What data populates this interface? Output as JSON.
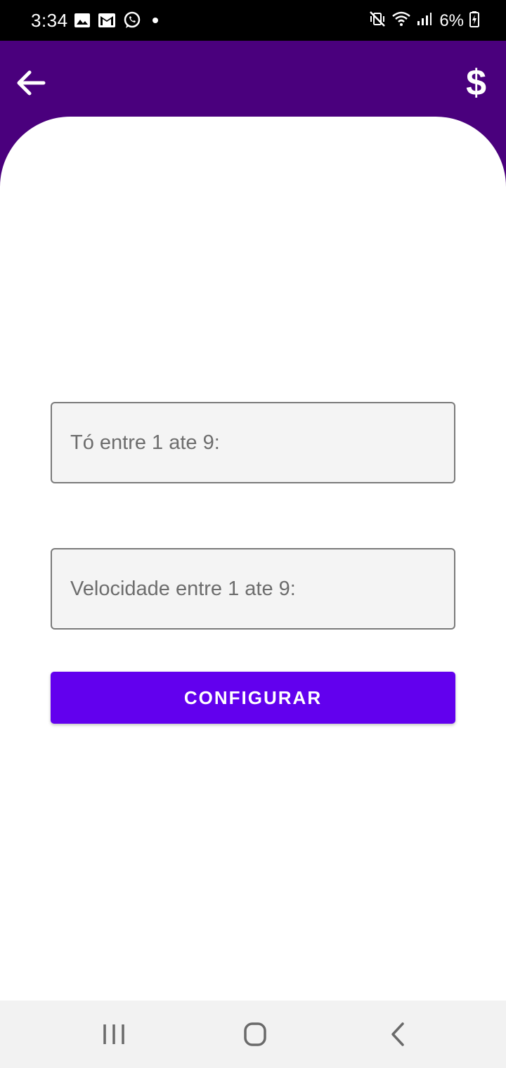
{
  "status_bar": {
    "time": "3:34",
    "battery": "6%",
    "left_icons": [
      "image-icon",
      "gmail-icon",
      "whatsapp-icon",
      "dot-icon"
    ],
    "right_icons": [
      "mute-vibrate-icon",
      "wifi-icon",
      "signal-icon",
      "battery-charging-icon"
    ]
  },
  "app_bar": {
    "back_icon": "arrow-left-icon",
    "action_symbol": "$",
    "color": "#4a007d"
  },
  "form": {
    "to_placeholder": "Tó entre 1 ate 9:",
    "velocidade_placeholder": "Velocidade entre 1 ate 9:",
    "submit_label": "CONFIGURAR",
    "submit_color": "#6200ee"
  },
  "nav_bar": {
    "items": [
      "recents-icon",
      "home-icon",
      "back-icon"
    ]
  }
}
